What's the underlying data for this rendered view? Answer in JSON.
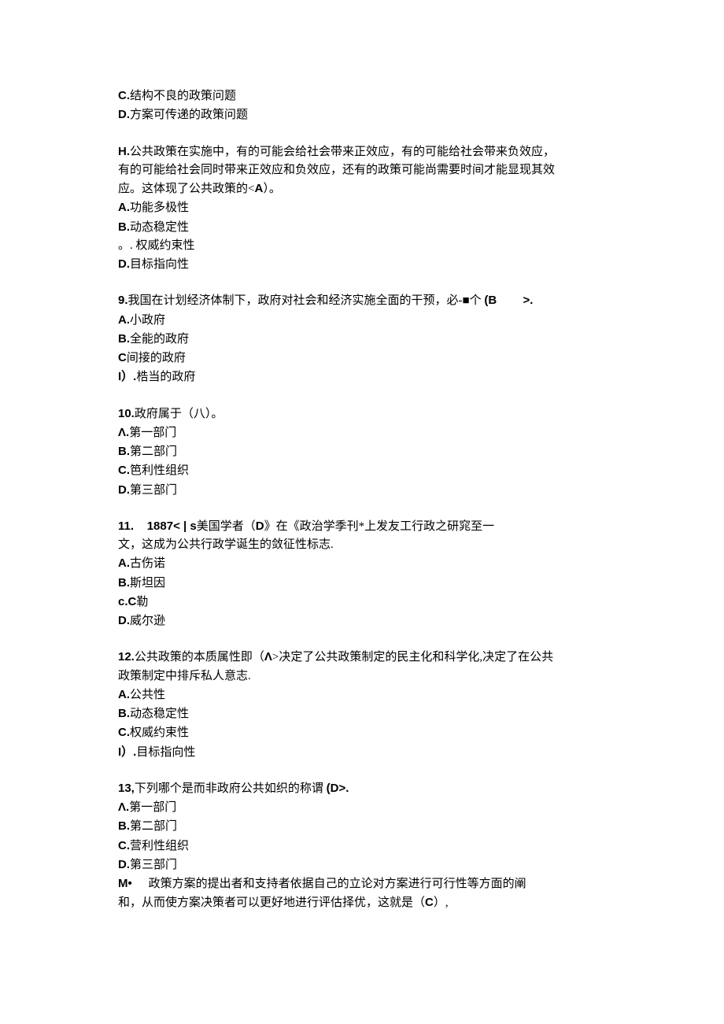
{
  "q7": {
    "optC": "C.结构不良的政策问题",
    "optD": "D.方案可传递的政策问题"
  },
  "q8": {
    "stem1": "H.公共政策在实施中，有的可能会给社会带来正效应，有的可能给社会带来负效应，",
    "stem2": "有的可能给社会同时带来正效应和负效应，还有的政策可能尚需要时间才能显现其效",
    "stem3": "应。这体现了公共政策的<A）。",
    "optA": "A.功能多极性",
    "optB": "B.动态稳定性",
    "optC": "。. 权威约束性",
    "optD": "D.目标指向性"
  },
  "q9": {
    "stem": "9.我国在计划经济体制下，政府对社会和经济实施全面的干预，必-■个  (B        >.",
    "optA": "A.小政府",
    "optB": "B.全能的政府",
    "optC": "C间接的政府",
    "optD": "I）.梏当的政府"
  },
  "q10": {
    "stem": "10.政府属于（八）。",
    "optA": "Λ.第一部门",
    "optB": "B.第二部门",
    "optC": "C.笆利性组织",
    "optD": "D.第三部门"
  },
  "q11": {
    "stem1": "11.    1887< | s美国学者（D》在《政治学季刊*上发友工行政之研窕至一",
    "stem2": "文，这成为公共行政学诞生的敛征性标志.",
    "optA": "A.古伤诺",
    "optB": "B.斯坦因",
    "optC": "c.C勒",
    "optD": "D.威尔逊"
  },
  "q12": {
    "stem1": "12.公共政策的本质属性即（Λ>决定了公共政策制定的民主化和科学化,决定了在公共",
    "stem2": "政策制定中排斥私人意志.",
    "optA": "A.公共性",
    "optB": "B.动态稳定性",
    "optC": "C.权威约束性",
    "optD": "I）.目标指向性"
  },
  "q13": {
    "stem": "13,下列哪个是而非政府公共如织的称谓  (D>.",
    "optA": "Λ.第一部门",
    "optB": "B.第二部门",
    "optC": "C.营利性组织",
    "optD": "D.第三部门"
  },
  "q14": {
    "stem1": "M•     政策方案的提出者和支持者依据自己的立论对方案进行可行性等方面的阐",
    "stem2": "和，从而使方案决策者可以更好地进行评估择优，这就是（C）,"
  }
}
